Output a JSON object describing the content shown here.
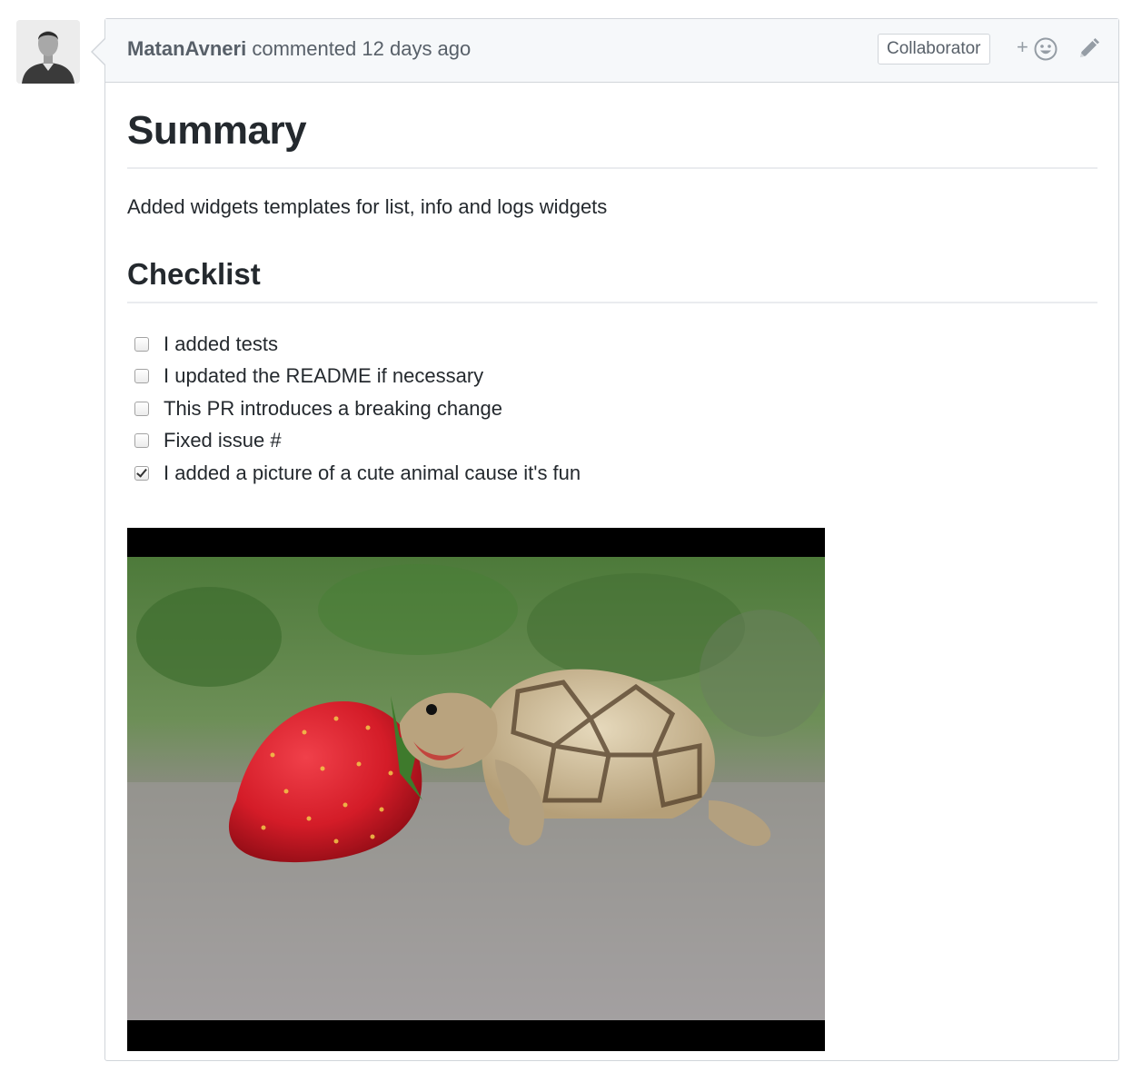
{
  "comment": {
    "author": "MatanAvneri",
    "action": " commented ",
    "timestamp": "12 days ago",
    "badge": "Collaborator",
    "reaction_plus": "+",
    "icons": {
      "avatar": "avatar",
      "reaction": "smiley-icon",
      "edit": "pencil-icon"
    }
  },
  "body": {
    "heading": "Summary",
    "description": "Added widgets templates for list, info and logs widgets",
    "checklist_heading": "Checklist",
    "tasks": [
      {
        "label": "I added tests",
        "checked": false
      },
      {
        "label": "I updated the README if necessary",
        "checked": false
      },
      {
        "label": "This PR introduces a breaking change",
        "checked": false
      },
      {
        "label": "Fixed issue #",
        "checked": false
      },
      {
        "label": "I added a picture of a cute animal cause it's fun",
        "checked": true
      }
    ]
  },
  "colors": {
    "header_bg": "#f6f8fa",
    "border": "#d1d5da",
    "text": "#24292e",
    "muted": "#586069"
  }
}
